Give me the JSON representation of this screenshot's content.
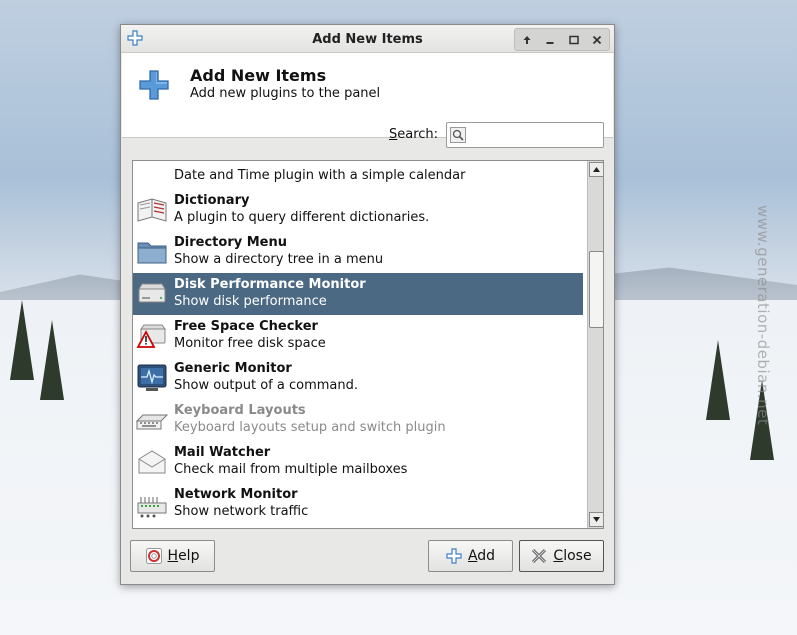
{
  "desktop": {
    "watermark": "www.generation-debian.net"
  },
  "window": {
    "title": "Add New Items",
    "controls": [
      "arrow-up-icon",
      "minimize-icon",
      "maximize-icon",
      "close-icon"
    ]
  },
  "header": {
    "title": "Add New Items",
    "subtitle": "Add new plugins to the panel"
  },
  "search": {
    "label": "Search:",
    "value": "",
    "placeholder": ""
  },
  "list": {
    "items": [
      {
        "name": "",
        "description": "Date and Time plugin with a simple calendar",
        "icon": "clock-icon",
        "state": "partial"
      },
      {
        "name": "Dictionary",
        "description": "A plugin to query different dictionaries.",
        "icon": "dictionary-icon",
        "state": "normal"
      },
      {
        "name": "Directory Menu",
        "description": "Show a directory tree in a menu",
        "icon": "folder-icon",
        "state": "normal"
      },
      {
        "name": "Disk Performance Monitor",
        "description": "Show disk performance",
        "icon": "disk-icon",
        "state": "selected"
      },
      {
        "name": "Free Space Checker",
        "description": "Monitor free disk space",
        "icon": "disk-warning-icon",
        "state": "normal"
      },
      {
        "name": "Generic Monitor",
        "description": "Show output of a command.",
        "icon": "monitor-icon",
        "state": "normal"
      },
      {
        "name": "Keyboard Layouts",
        "description": "Keyboard layouts setup and switch plugin",
        "icon": "keyboard-icon",
        "state": "disabled"
      },
      {
        "name": "Mail Watcher",
        "description": "Check mail from multiple mailboxes",
        "icon": "mail-icon",
        "state": "normal"
      },
      {
        "name": "Network Monitor",
        "description": "Show network traffic",
        "icon": "network-icon",
        "state": "normal"
      }
    ],
    "scroll_position": 0.42
  },
  "buttons": {
    "help": "Help",
    "add": "Add",
    "close": "Close"
  },
  "colors": {
    "selection": "#4b6983",
    "add_icon": "#3d7fc4"
  }
}
